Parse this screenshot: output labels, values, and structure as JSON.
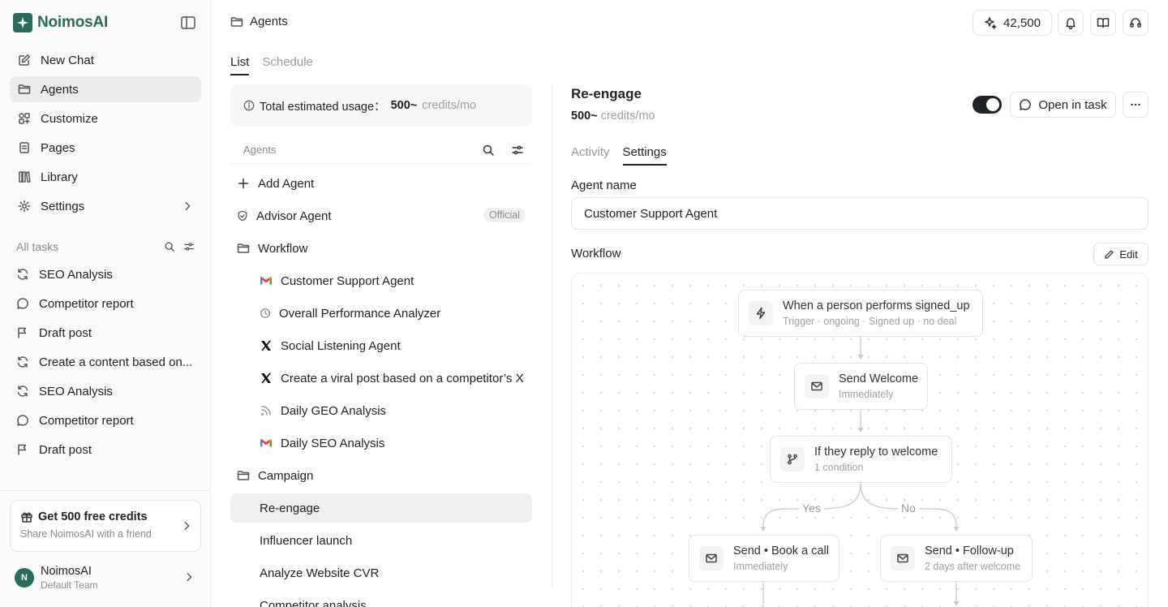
{
  "brand": {
    "name": "NoimosAI"
  },
  "sidebar": {
    "nav": [
      {
        "label": "New Chat",
        "icon": "edit-icon"
      },
      {
        "label": "Agents",
        "icon": "folder-icon",
        "active": true
      },
      {
        "label": "Customize",
        "icon": "grid-icon"
      },
      {
        "label": "Pages",
        "icon": "pages-icon"
      },
      {
        "label": "Library",
        "icon": "library-icon"
      },
      {
        "label": "Settings",
        "icon": "gear-icon"
      }
    ],
    "tasks_header": "All tasks",
    "tasks": [
      {
        "label": "SEO Analysis",
        "icon": "refresh-icon"
      },
      {
        "label": "Competitor report",
        "icon": "chat-bubble-icon"
      },
      {
        "label": "Draft post",
        "icon": "flag-icon"
      },
      {
        "label": "Create a content based on...",
        "icon": "refresh-icon"
      },
      {
        "label": "SEO Analysis",
        "icon": "refresh-icon"
      },
      {
        "label": "Competitor report",
        "icon": "chat-bubble-icon"
      },
      {
        "label": "Draft post",
        "icon": "flag-icon"
      }
    ],
    "promo": {
      "title": "Get 500 free credits",
      "subtitle": "Share NoimosAI with a friend"
    },
    "user": {
      "initial": "N",
      "name": "NoimosAI",
      "team": "Default Team"
    }
  },
  "topbar": {
    "breadcrumb": "Agents",
    "credits": "42,500"
  },
  "tabs": [
    "List",
    "Schedule"
  ],
  "usage": {
    "label": "Total estimated usage：",
    "value": "500~",
    "unit": "credits/mo"
  },
  "agents_list": {
    "header": "Agents",
    "add_label": "Add Agent",
    "advisor": {
      "label": "Advisor Agent",
      "badge": "Official"
    },
    "workflow_folder": "Workflow",
    "workflow_items": [
      {
        "label": "Customer Support Agent",
        "icon": "gmail-icon"
      },
      {
        "label": "Overall Performance Analyzer",
        "icon": "clock-icon"
      },
      {
        "label": "Social Listening Agent",
        "icon": "x-logo-icon"
      },
      {
        "label": "Create a viral post based on a competitor’s X",
        "icon": "x-logo-icon"
      },
      {
        "label": "Daily GEO Analysis",
        "icon": "rss-icon"
      },
      {
        "label": "Daily SEO Analysis",
        "icon": "gmail-icon"
      }
    ],
    "campaign_folder": "Campaign",
    "campaign_items": [
      "Re-engage",
      "Influencer launch",
      "Analyze Website CVR",
      "Competitor analysis"
    ]
  },
  "detail": {
    "title": "Re-engage",
    "credits_value": "500~",
    "credits_unit": "credits/mo",
    "enabled": true,
    "open_label": "Open in task",
    "tabs": [
      "Activity",
      "Settings"
    ],
    "agent_name_label": "Agent name",
    "agent_name_value": "Customer Support Agent",
    "workflow_label": "Workflow",
    "edit_label": "Edit",
    "nodes": {
      "trigger": {
        "title": "When a person performs signed_up",
        "sub": "Trigger · ongoing · Signed up · no deal"
      },
      "welcome": {
        "title": "Send Welcome",
        "sub": "Immediately"
      },
      "condition": {
        "title": "If they reply to welcome",
        "sub": "1 condition"
      },
      "book": {
        "title": "Send • Book a call",
        "sub": "Immediately"
      },
      "followup": {
        "title": "Send • Follow-up",
        "sub": "2 days after welcome"
      }
    },
    "branch_yes": "Yes",
    "branch_no": "No"
  }
}
